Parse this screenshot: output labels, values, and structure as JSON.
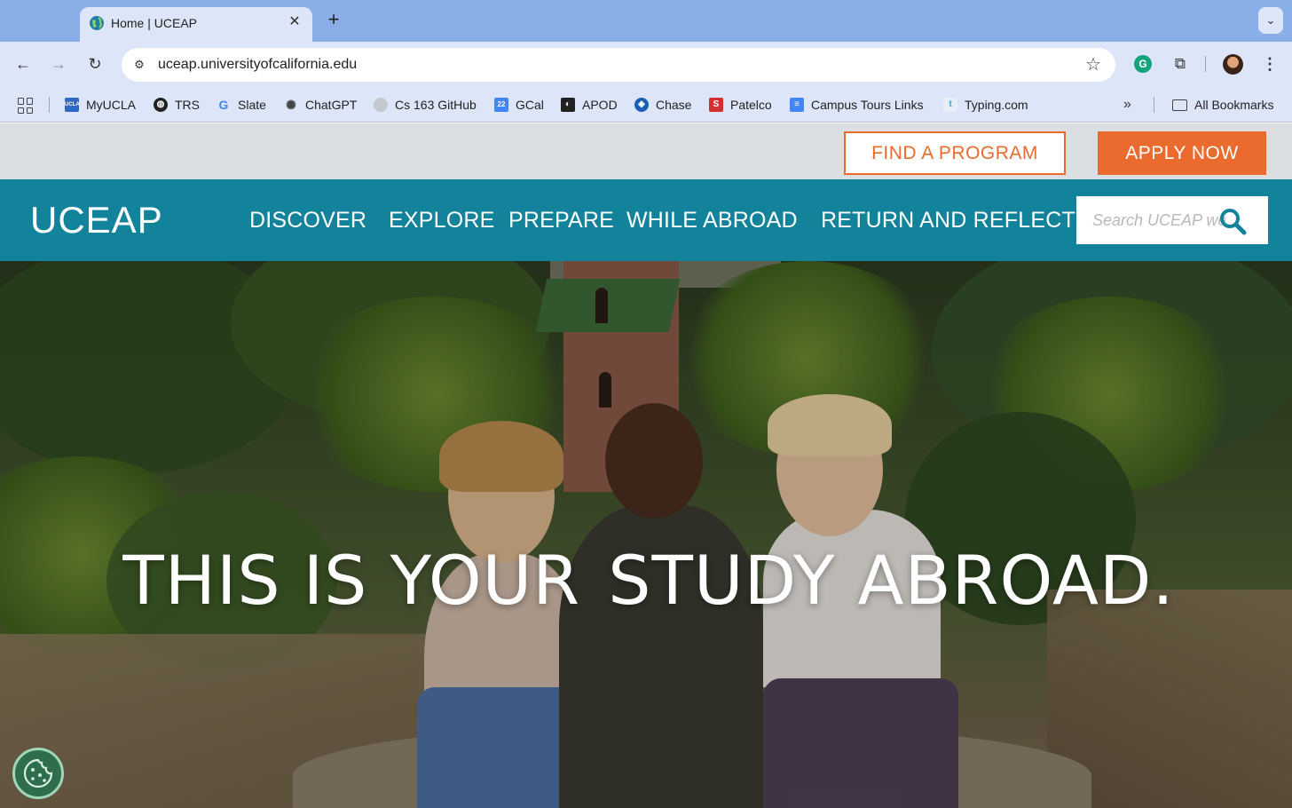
{
  "browser": {
    "tab": {
      "title": "Home | UCEAP"
    },
    "omnibox": {
      "url": "uceap.universityofcalifornia.edu"
    },
    "bookmarks": [
      {
        "label": "MyUCLA",
        "icon": "ucla-icon",
        "color": "#2d68c4"
      },
      {
        "label": "TRS",
        "icon": "globe-icon",
        "color": "#222222"
      },
      {
        "label": "Slate",
        "icon": "google-icon",
        "color": "#4285f4"
      },
      {
        "label": "ChatGPT",
        "icon": "openai-icon",
        "color": "#444444"
      },
      {
        "label": "Cs 163 GitHub",
        "icon": "github-icon",
        "color": "#777777"
      },
      {
        "label": "GCal",
        "icon": "calendar-icon",
        "color": "#4285f4"
      },
      {
        "label": "APOD",
        "icon": "nasa-icon",
        "color": "#222222"
      },
      {
        "label": "Chase",
        "icon": "chase-icon",
        "color": "#1a5fb4"
      },
      {
        "label": "Patelco",
        "icon": "patelco-icon",
        "color": "#d32f2f"
      },
      {
        "label": "Campus Tours Links",
        "icon": "docs-icon",
        "color": "#4285f4"
      },
      {
        "label": "Typing.com",
        "icon": "typing-icon",
        "color": "#3aa0d8"
      }
    ],
    "all_bookmarks_label": "All Bookmarks",
    "more_label": "»"
  },
  "site": {
    "find_program_label": "FIND A PROGRAM",
    "apply_now_label": "APPLY NOW",
    "logo": "UCEAP",
    "nav": [
      "DISCOVER",
      "EXPLORE",
      "PREPARE",
      "WHILE ABROAD",
      "RETURN AND REFLECT"
    ],
    "search": {
      "placeholder": "Search UCEAP website"
    },
    "hero": {
      "title_part1": "THIS IS YOUR",
      "title_part2": "STUDY ABROAD."
    },
    "colors": {
      "brand_teal": "#13829b",
      "accent_orange": "#ea6b2d",
      "utility_gray": "#dcdfe2"
    }
  }
}
